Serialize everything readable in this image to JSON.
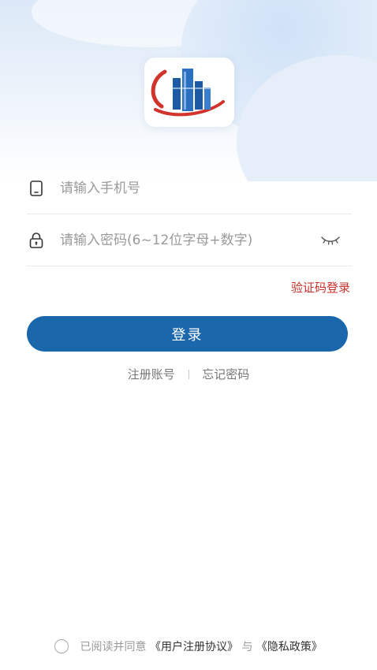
{
  "login": {
    "phone_placeholder": "请输入手机号",
    "password_placeholder": "请输入密码(6~12位字母+数字)",
    "sms_login_label": "验证码登录",
    "login_button_label": "登录",
    "register_label": "注册账号",
    "forgot_password_label": "忘记密码"
  },
  "agreement": {
    "prefix": "已阅读并同意",
    "user_agreement": "《用户注册协议》",
    "conjunction": "与",
    "privacy_policy": "《隐私政策》",
    "checked": false
  },
  "icons": {
    "phone": "phone-icon",
    "lock": "lock-icon",
    "password_visibility": "eye-closed-icon"
  },
  "colors": {
    "primary": "#1a67ac",
    "sms_link": "#c8312b",
    "logo_red": "#d0342c",
    "logo_blue": "#1d5aa6"
  }
}
